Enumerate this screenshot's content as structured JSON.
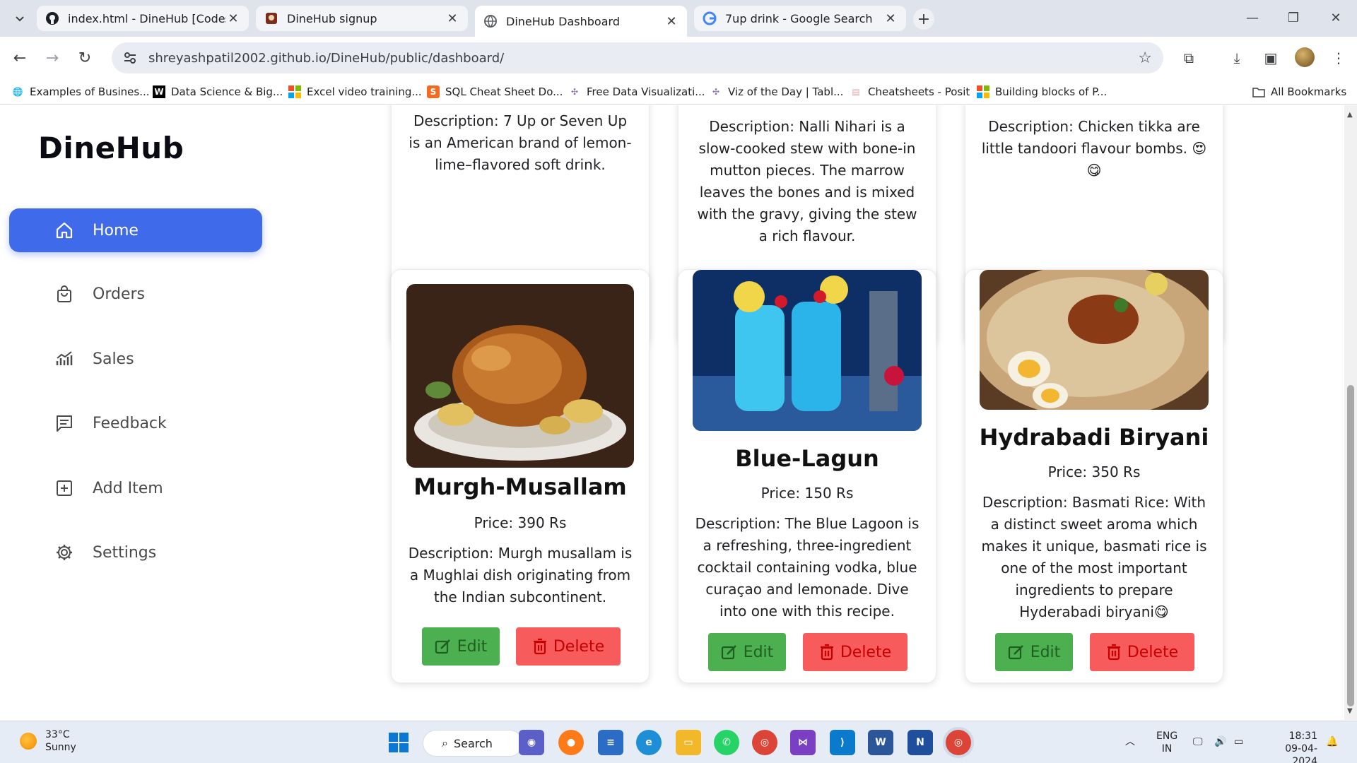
{
  "browser": {
    "tabs": [
      {
        "title": "index.html - DineHub [Codespa",
        "active": false,
        "icon": "github-icon"
      },
      {
        "title": "DineHub signup",
        "active": false,
        "icon": "dinehub-signup-icon"
      },
      {
        "title": "DineHub Dashboard",
        "active": true,
        "icon": "globe-icon"
      },
      {
        "title": "7up drink - Google Search",
        "active": false,
        "icon": "google-icon"
      }
    ],
    "url": "shreyashpatil2002.github.io/DineHub/public/dashboard/",
    "bookmarks": [
      "Examples of Busines...",
      "Data Science & Big...",
      "Excel video training...",
      "SQL Cheat Sheet Do...",
      "Free Data Visualizati...",
      "Viz of the Day | Tabl...",
      "Cheatsheets - Posit",
      "Building blocks of P...",
      "All Bookmarks"
    ]
  },
  "app": {
    "brand": "DineHub",
    "accent_color": "#3f6bea",
    "nav": [
      {
        "label": "Home",
        "icon": "home-icon",
        "active": true
      },
      {
        "label": "Orders",
        "icon": "shopping-bag-icon",
        "active": false
      },
      {
        "label": "Sales",
        "icon": "sales-chart-icon",
        "active": false
      },
      {
        "label": "Feedback",
        "icon": "message-icon",
        "active": false
      },
      {
        "label": "Add Item",
        "icon": "plus-square-icon",
        "active": false
      },
      {
        "label": "Settings",
        "icon": "gear-icon",
        "active": false
      }
    ],
    "edit_label": "Edit",
    "delete_label": "Delete",
    "top_cards": [
      {
        "description": "Description: 7 Up or Seven Up is an American brand of lemon-lime–flavored soft drink."
      },
      {
        "description": "Description: Nalli Nihari is a slow-cooked stew with bone-in mutton pieces. The marrow leaves the bones and is mixed with the gravy, giving the stew a rich flavour."
      },
      {
        "description": "Description: Chicken tikka are little tandoori flavour bombs. 😍 😋"
      }
    ],
    "items": [
      {
        "name": "Murgh-Musallam",
        "price": "Price: 390 Rs",
        "description": "Description: Murgh musallam is a Mughlai dish originating from the Indian subcontinent.",
        "image": "roast-chicken-image"
      },
      {
        "name": "Blue-Lagun",
        "price": "Price: 150 Rs",
        "description": "Description: The Blue Lagoon is a refreshing, three-ingredient cocktail containing vodka, blue curaçao and lemonade. Dive into one with this recipe.",
        "image": "blue-cocktail-image"
      },
      {
        "name": "Hydrabadi Biryani",
        "price": "Price: 350 Rs",
        "description": "Description: Basmati Rice: With a distinct sweet aroma which makes it unique, basmati rice is one of the most important ingredients to prepare Hyderabadi biryani😋",
        "image": "biryani-image"
      }
    ]
  },
  "taskbar": {
    "temperature": "33°C",
    "weather": "Sunny",
    "search": "Search",
    "lang1": "ENG",
    "lang2": "IN",
    "time": "18:31",
    "date": "09-04-2024"
  }
}
